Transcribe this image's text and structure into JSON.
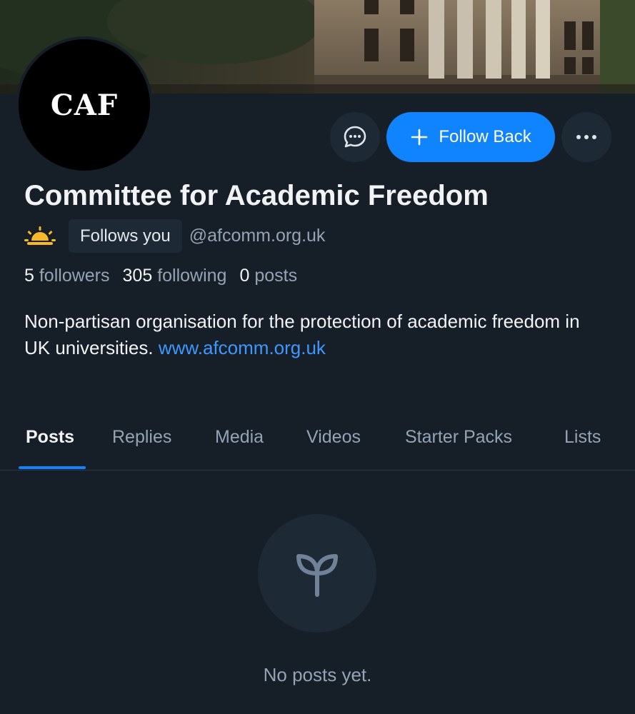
{
  "banner": {
    "icon": "building-photo"
  },
  "avatar": {
    "text": "CAF"
  },
  "actions": {
    "message_icon": "chat-bubble-icon",
    "follow_label": "Follow Back",
    "more_icon": "ellipsis-icon"
  },
  "profile": {
    "display_name": "Committee for Academic Freedom",
    "badge_icon": "sunrise-icon",
    "follows_you": "Follows you",
    "handle": "@afcomm.org.uk",
    "stats": {
      "followers_count": "5",
      "followers_label": "followers",
      "following_count": "305",
      "following_label": "following",
      "posts_count": "0",
      "posts_label": "posts"
    },
    "bio_text": "Non-partisan organisation for the protection of academic freedom in UK universities.",
    "bio_link": "www.afcomm.org.uk"
  },
  "tabs": [
    {
      "label": "Posts",
      "active": true
    },
    {
      "label": "Replies",
      "active": false
    },
    {
      "label": "Media",
      "active": false
    },
    {
      "label": "Videos",
      "active": false
    },
    {
      "label": "Starter Packs",
      "active": false
    },
    {
      "label": "Lists",
      "active": false
    }
  ],
  "empty_state": {
    "icon": "sprout-icon",
    "text": "No posts yet."
  },
  "colors": {
    "background": "#161e27",
    "surface": "#1e2936",
    "accent": "#1083fe",
    "link": "#3d98ff",
    "muted_text": "#95a3b4"
  }
}
